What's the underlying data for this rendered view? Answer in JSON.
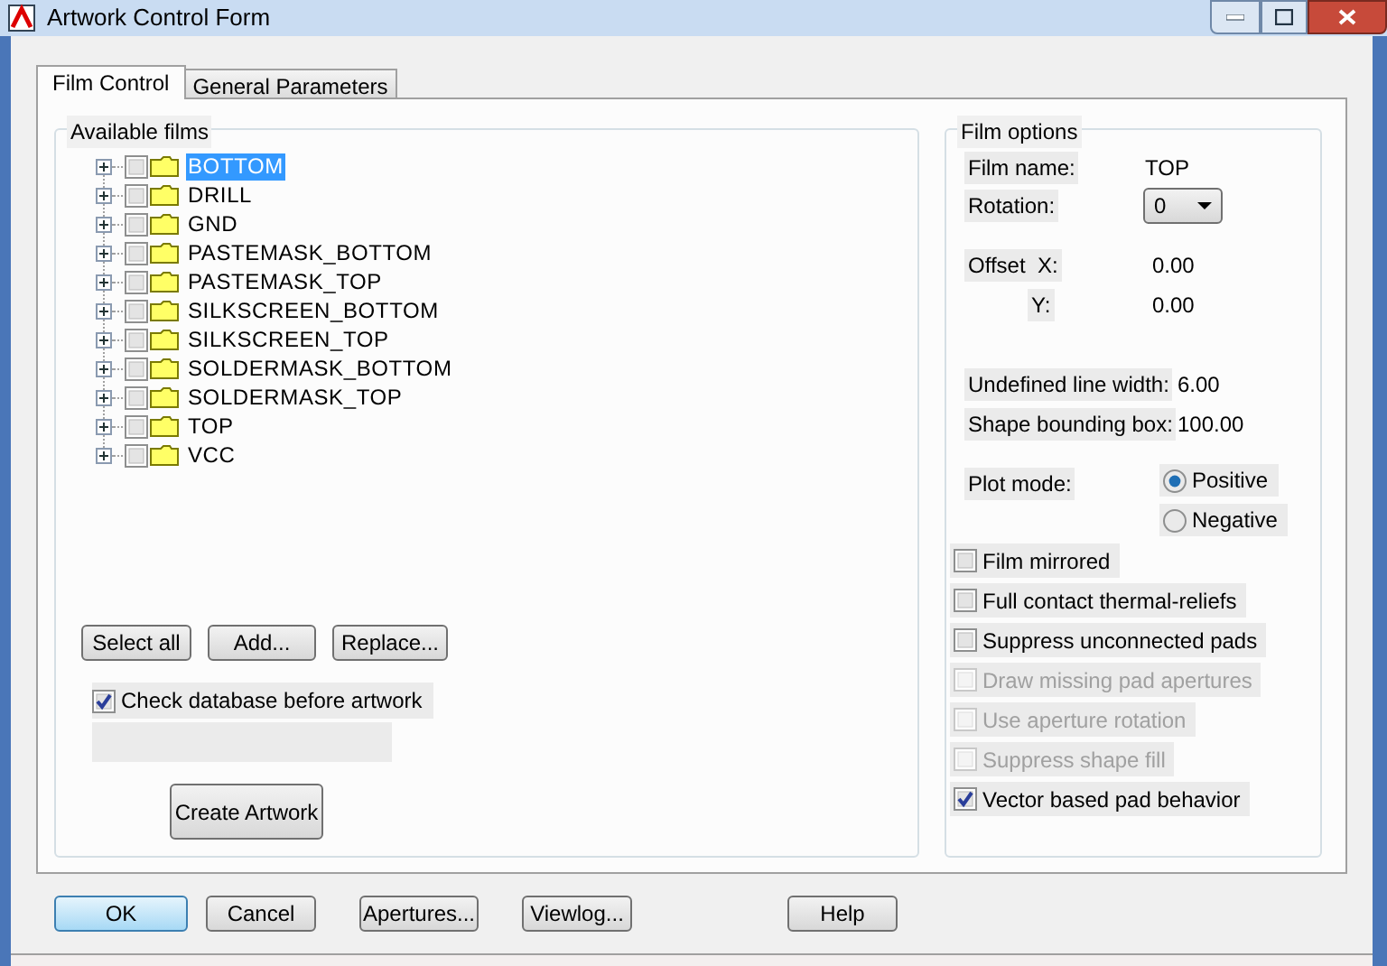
{
  "window": {
    "title": "Artwork Control Form"
  },
  "tabs": [
    {
      "label": "Film Control",
      "selected": true
    },
    {
      "label": "General Parameters",
      "selected": false
    }
  ],
  "available_films": {
    "title": "Available films",
    "items": [
      {
        "label": "BOTTOM",
        "checked": false,
        "selected": true
      },
      {
        "label": "DRILL",
        "checked": false,
        "selected": false
      },
      {
        "label": "GND",
        "checked": false,
        "selected": false
      },
      {
        "label": "PASTEMASK_BOTTOM",
        "checked": false,
        "selected": false
      },
      {
        "label": "PASTEMASK_TOP",
        "checked": false,
        "selected": false
      },
      {
        "label": "SILKSCREEN_BOTTOM",
        "checked": false,
        "selected": false
      },
      {
        "label": "SILKSCREEN_TOP",
        "checked": false,
        "selected": false
      },
      {
        "label": "SOLDERMASK_BOTTOM",
        "checked": false,
        "selected": false
      },
      {
        "label": "SOLDERMASK_TOP",
        "checked": false,
        "selected": false
      },
      {
        "label": "TOP",
        "checked": false,
        "selected": false
      },
      {
        "label": "VCC",
        "checked": false,
        "selected": false
      }
    ],
    "buttons": [
      "Select all",
      "Add...",
      "Replace..."
    ],
    "check_database": {
      "label": "Check database before artwork",
      "checked": true
    },
    "create_button": "Create Artwork"
  },
  "film_options": {
    "title": "Film options",
    "film_name": {
      "label": "Film name:",
      "value": "TOP"
    },
    "rotation": {
      "label": "Rotation:",
      "value": "0"
    },
    "offset": {
      "label": "Offset",
      "x_label": "X:",
      "x_value": "0.00",
      "y_label": "Y:",
      "y_value": "0.00"
    },
    "undefined_line_width": {
      "label": "Undefined line width:",
      "value": "6.00"
    },
    "shape_bounding_box": {
      "label": "Shape bounding box:",
      "value": "100.00"
    },
    "plot_mode": {
      "label": "Plot mode:",
      "options": [
        {
          "label": "Positive",
          "selected": true
        },
        {
          "label": "Negative",
          "selected": false
        }
      ]
    },
    "checkboxes": [
      {
        "label": "Film mirrored",
        "checked": false,
        "disabled": false
      },
      {
        "label": "Full contact thermal-reliefs",
        "checked": false,
        "disabled": false
      },
      {
        "label": "Suppress unconnected pads",
        "checked": false,
        "disabled": false
      },
      {
        "label": "Draw missing pad apertures",
        "checked": false,
        "disabled": true
      },
      {
        "label": "Use aperture rotation",
        "checked": false,
        "disabled": true
      },
      {
        "label": "Suppress shape fill",
        "checked": false,
        "disabled": true
      },
      {
        "label": "Vector based pad behavior",
        "checked": true,
        "disabled": false
      }
    ]
  },
  "footer_buttons": [
    {
      "label": "OK",
      "default": true
    },
    {
      "label": "Cancel",
      "default": false
    },
    {
      "label": "Apertures...",
      "default": false
    },
    {
      "label": "Viewlog...",
      "default": false
    },
    {
      "label": "Help",
      "default": false
    }
  ]
}
